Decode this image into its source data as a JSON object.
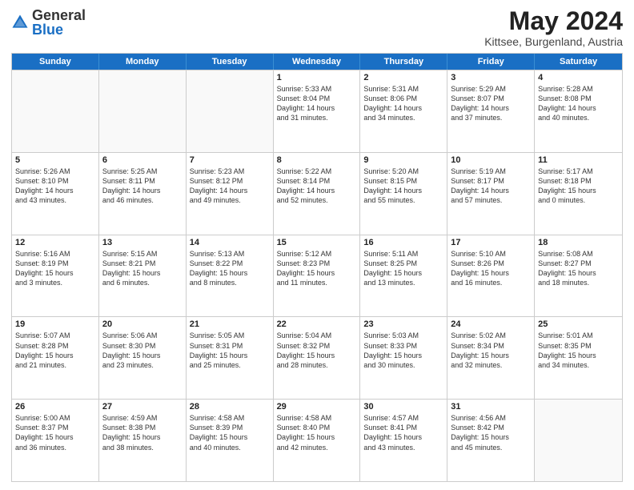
{
  "logo": {
    "general": "General",
    "blue": "Blue"
  },
  "title": {
    "month": "May 2024",
    "location": "Kittsee, Burgenland, Austria"
  },
  "days": [
    "Sunday",
    "Monday",
    "Tuesday",
    "Wednesday",
    "Thursday",
    "Friday",
    "Saturday"
  ],
  "weeks": [
    [
      {
        "day": "",
        "info": ""
      },
      {
        "day": "",
        "info": ""
      },
      {
        "day": "",
        "info": ""
      },
      {
        "day": "1",
        "info": "Sunrise: 5:33 AM\nSunset: 8:04 PM\nDaylight: 14 hours\nand 31 minutes."
      },
      {
        "day": "2",
        "info": "Sunrise: 5:31 AM\nSunset: 8:06 PM\nDaylight: 14 hours\nand 34 minutes."
      },
      {
        "day": "3",
        "info": "Sunrise: 5:29 AM\nSunset: 8:07 PM\nDaylight: 14 hours\nand 37 minutes."
      },
      {
        "day": "4",
        "info": "Sunrise: 5:28 AM\nSunset: 8:08 PM\nDaylight: 14 hours\nand 40 minutes."
      }
    ],
    [
      {
        "day": "5",
        "info": "Sunrise: 5:26 AM\nSunset: 8:10 PM\nDaylight: 14 hours\nand 43 minutes."
      },
      {
        "day": "6",
        "info": "Sunrise: 5:25 AM\nSunset: 8:11 PM\nDaylight: 14 hours\nand 46 minutes."
      },
      {
        "day": "7",
        "info": "Sunrise: 5:23 AM\nSunset: 8:12 PM\nDaylight: 14 hours\nand 49 minutes."
      },
      {
        "day": "8",
        "info": "Sunrise: 5:22 AM\nSunset: 8:14 PM\nDaylight: 14 hours\nand 52 minutes."
      },
      {
        "day": "9",
        "info": "Sunrise: 5:20 AM\nSunset: 8:15 PM\nDaylight: 14 hours\nand 55 minutes."
      },
      {
        "day": "10",
        "info": "Sunrise: 5:19 AM\nSunset: 8:17 PM\nDaylight: 14 hours\nand 57 minutes."
      },
      {
        "day": "11",
        "info": "Sunrise: 5:17 AM\nSunset: 8:18 PM\nDaylight: 15 hours\nand 0 minutes."
      }
    ],
    [
      {
        "day": "12",
        "info": "Sunrise: 5:16 AM\nSunset: 8:19 PM\nDaylight: 15 hours\nand 3 minutes."
      },
      {
        "day": "13",
        "info": "Sunrise: 5:15 AM\nSunset: 8:21 PM\nDaylight: 15 hours\nand 6 minutes."
      },
      {
        "day": "14",
        "info": "Sunrise: 5:13 AM\nSunset: 8:22 PM\nDaylight: 15 hours\nand 8 minutes."
      },
      {
        "day": "15",
        "info": "Sunrise: 5:12 AM\nSunset: 8:23 PM\nDaylight: 15 hours\nand 11 minutes."
      },
      {
        "day": "16",
        "info": "Sunrise: 5:11 AM\nSunset: 8:25 PM\nDaylight: 15 hours\nand 13 minutes."
      },
      {
        "day": "17",
        "info": "Sunrise: 5:10 AM\nSunset: 8:26 PM\nDaylight: 15 hours\nand 16 minutes."
      },
      {
        "day": "18",
        "info": "Sunrise: 5:08 AM\nSunset: 8:27 PM\nDaylight: 15 hours\nand 18 minutes."
      }
    ],
    [
      {
        "day": "19",
        "info": "Sunrise: 5:07 AM\nSunset: 8:28 PM\nDaylight: 15 hours\nand 21 minutes."
      },
      {
        "day": "20",
        "info": "Sunrise: 5:06 AM\nSunset: 8:30 PM\nDaylight: 15 hours\nand 23 minutes."
      },
      {
        "day": "21",
        "info": "Sunrise: 5:05 AM\nSunset: 8:31 PM\nDaylight: 15 hours\nand 25 minutes."
      },
      {
        "day": "22",
        "info": "Sunrise: 5:04 AM\nSunset: 8:32 PM\nDaylight: 15 hours\nand 28 minutes."
      },
      {
        "day": "23",
        "info": "Sunrise: 5:03 AM\nSunset: 8:33 PM\nDaylight: 15 hours\nand 30 minutes."
      },
      {
        "day": "24",
        "info": "Sunrise: 5:02 AM\nSunset: 8:34 PM\nDaylight: 15 hours\nand 32 minutes."
      },
      {
        "day": "25",
        "info": "Sunrise: 5:01 AM\nSunset: 8:35 PM\nDaylight: 15 hours\nand 34 minutes."
      }
    ],
    [
      {
        "day": "26",
        "info": "Sunrise: 5:00 AM\nSunset: 8:37 PM\nDaylight: 15 hours\nand 36 minutes."
      },
      {
        "day": "27",
        "info": "Sunrise: 4:59 AM\nSunset: 8:38 PM\nDaylight: 15 hours\nand 38 minutes."
      },
      {
        "day": "28",
        "info": "Sunrise: 4:58 AM\nSunset: 8:39 PM\nDaylight: 15 hours\nand 40 minutes."
      },
      {
        "day": "29",
        "info": "Sunrise: 4:58 AM\nSunset: 8:40 PM\nDaylight: 15 hours\nand 42 minutes."
      },
      {
        "day": "30",
        "info": "Sunrise: 4:57 AM\nSunset: 8:41 PM\nDaylight: 15 hours\nand 43 minutes."
      },
      {
        "day": "31",
        "info": "Sunrise: 4:56 AM\nSunset: 8:42 PM\nDaylight: 15 hours\nand 45 minutes."
      },
      {
        "day": "",
        "info": ""
      }
    ]
  ]
}
